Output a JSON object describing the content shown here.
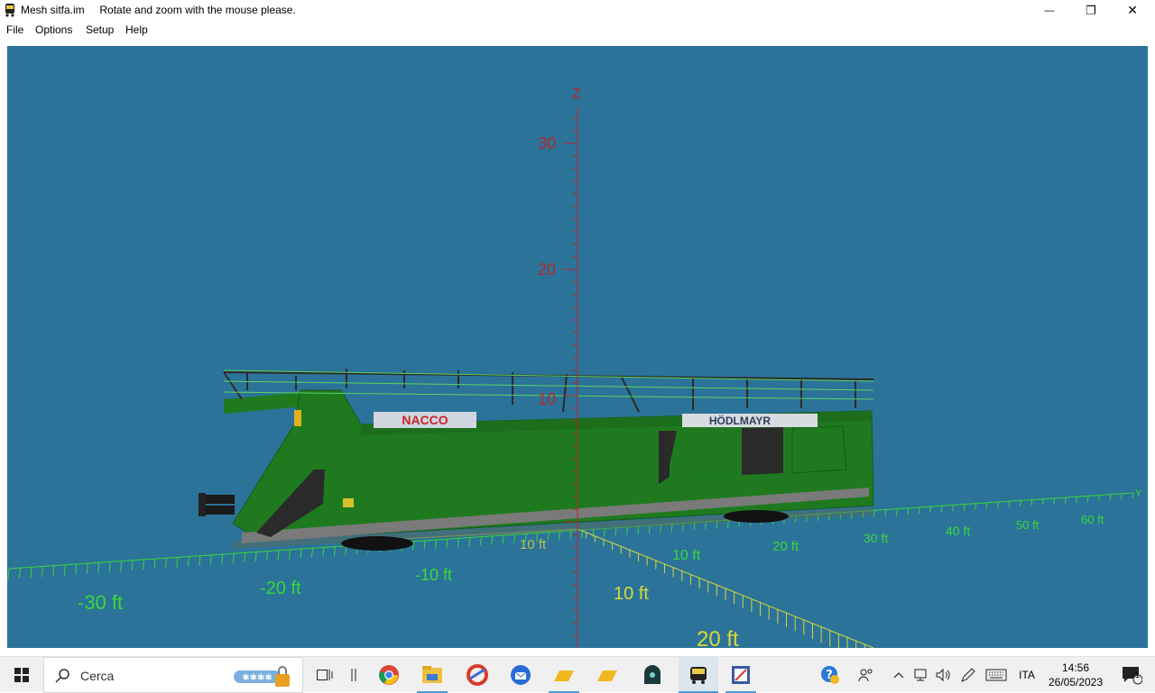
{
  "window": {
    "app_name": "Mesh sitfa.im",
    "hint": "Rotate and zoom with the mouse please.",
    "minimize_glyph": "—",
    "restore_glyph": "❐",
    "close_glyph": "✕"
  },
  "menu": [
    "File",
    "Options",
    "Setup",
    "Help"
  ],
  "scene": {
    "z_axis_label": "Z",
    "y_axis_label": "Y",
    "z_ticks": [
      "30",
      "20",
      "10"
    ],
    "y_ticks": [
      "-30 ft",
      "-20 ft",
      "-10 ft",
      "10 ft",
      "20 ft",
      "30 ft",
      "40 ft",
      "50 ft",
      "60 ft"
    ],
    "x_ticks": [
      "10 ft",
      "20 ft"
    ],
    "model_labels": {
      "left_banner": "NACCO",
      "right_banner": "HÖDLMAYR"
    },
    "colors": {
      "background": "#2b7399",
      "z_axis": "#b02a2a",
      "y_axis": "#39d839",
      "x_axis": "#d8d83a",
      "wagon": "#1f7a1f"
    }
  },
  "taskbar": {
    "search_placeholder": "Cerca",
    "language": "ITA",
    "time": "14:56",
    "date": "26/05/2023",
    "notification_count": "1",
    "apps": [
      "task-view",
      "explorer-panel",
      "chrome",
      "file-explorer",
      "ccleaner",
      "thunderbird",
      "folder-yellow",
      "folder-yellow-2",
      "train-app",
      "bus-app",
      "pdf-app"
    ]
  }
}
